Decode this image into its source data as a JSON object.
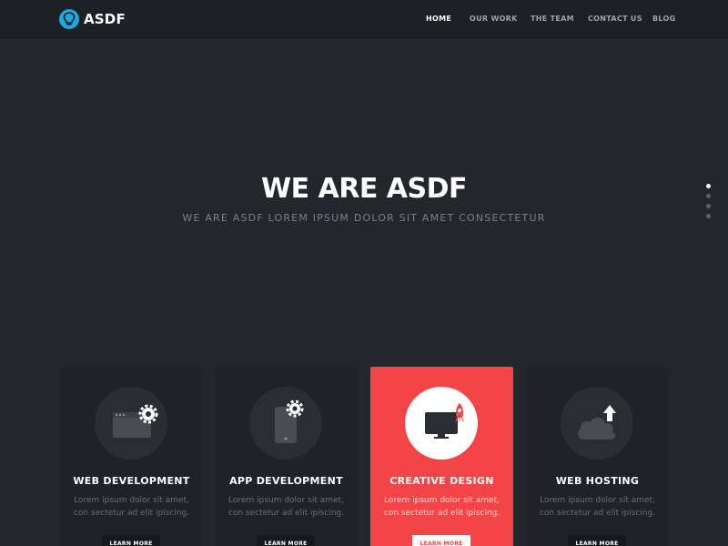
{
  "header": {
    "logo_text": "ASDF",
    "logo_icon": "lightbulb-icon",
    "nav": [
      {
        "label": "HOME",
        "active": true
      },
      {
        "label": "OUR WORK",
        "active": false
      },
      {
        "label": "THE TEAM",
        "active": false
      },
      {
        "label": "CONTACT US",
        "active": false
      },
      {
        "label": "BLOG",
        "active": false
      }
    ]
  },
  "hero": {
    "title": "WE ARE ASDF",
    "subtitle": "WE ARE ASDF LOREM IPSUM DOLOR SIT AMET CONSECTETUR",
    "slide_count": 4,
    "active_slide": 1
  },
  "services": [
    {
      "icon": "browser-gear-icon",
      "title": "WEB DEVELOPMENT",
      "text": "Lorem ipsum dolor sit amet, con sectetur ad elit ipiscing.",
      "button": "LEARN MORE",
      "highlighted": false
    },
    {
      "icon": "phone-gear-icon",
      "title": "APP DEVELOPMENT",
      "text": "Lorem ipsum dolor sit amet, con sectetur ad elit ipiscing.",
      "button": "LEARN MORE",
      "highlighted": false
    },
    {
      "icon": "monitor-rocket-icon",
      "title": "CREATIVE DESIGN",
      "text": "Lorem ipsum dolor sit amet, con sectetur ad elit ipiscing.",
      "button": "LEARN MORE",
      "highlighted": true
    },
    {
      "icon": "cloud-upload-icon",
      "title": "WEB HOSTING",
      "text": "Lorem ipsum dolor sit amet, con sectetur ad elit ipiscing.",
      "button": "LEARN MORE",
      "highlighted": false
    }
  ],
  "colors": {
    "background": "#23262b",
    "header": "#1d2024",
    "accent": "#f34547",
    "logo": "#1fa8e0"
  }
}
